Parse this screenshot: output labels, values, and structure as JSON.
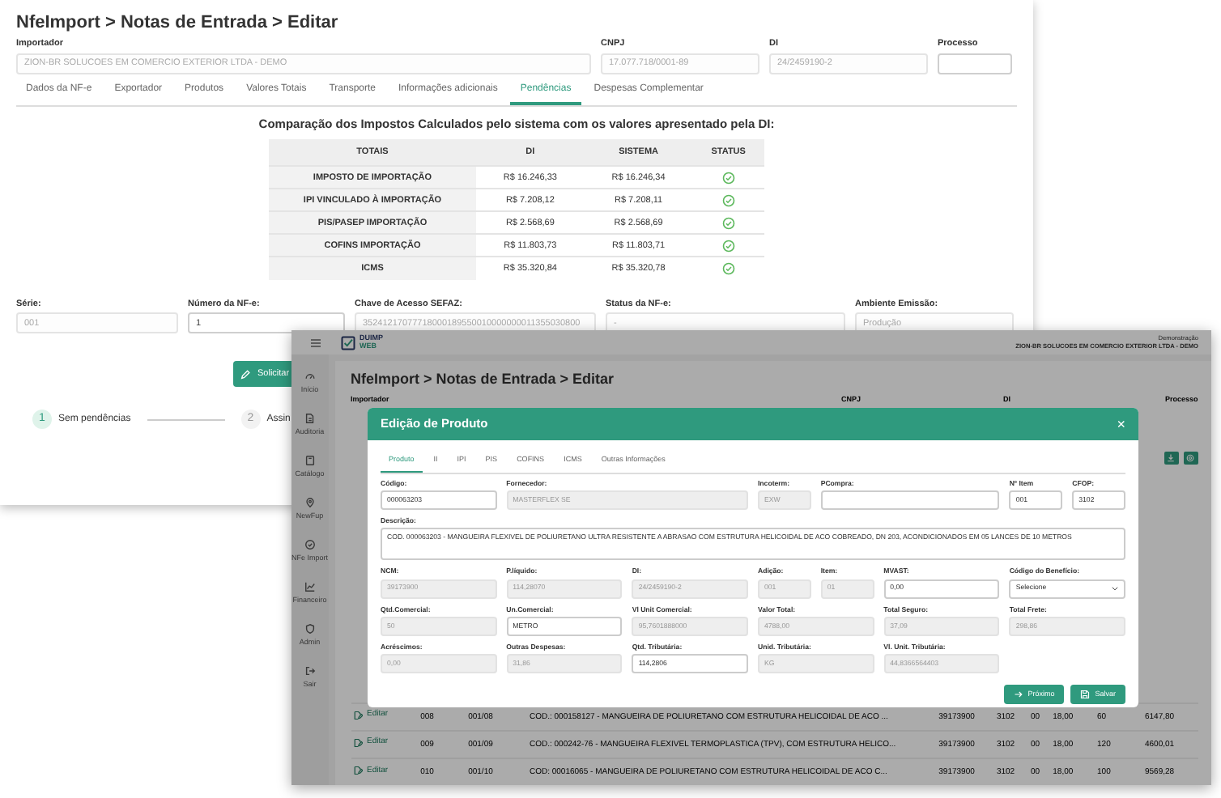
{
  "background_window": {
    "title": "NfeImport > Notas de Entrada > Editar",
    "header_fields": [
      {
        "label": "Importador",
        "value": "ZION-BR SOLUCOES EM COMERCIO EXTERIOR LTDA - DEMO",
        "disabled": true
      },
      {
        "label": "CNPJ",
        "value": "17.077.718/0001-89",
        "disabled": true
      },
      {
        "label": "DI",
        "value": "24/2459190-2",
        "disabled": true
      },
      {
        "label": "Processo",
        "disabled": false
      }
    ],
    "tabs": [
      {
        "label": "Dados da NF-e",
        "selected": false
      },
      {
        "label": "Exportador",
        "selected": false
      },
      {
        "label": "Produtos",
        "selected": false
      },
      {
        "label": "Valores Totais",
        "selected": false
      },
      {
        "label": "Transporte",
        "selected": false
      },
      {
        "label": "Informações adicionais",
        "selected": false
      },
      {
        "label": "Pendências",
        "selected": true
      },
      {
        "label": "Despesas Complementar",
        "selected": false
      }
    ],
    "comparison": {
      "heading": "Comparação dos Impostos Calculados pelo sistema com os valores apresentado pela DI:",
      "columns": [
        "TOTAIS",
        "DI",
        "SISTEMA",
        "STATUS"
      ],
      "rows": [
        {
          "label": "IMPOSTO DE IMPORTAÇÃO",
          "di": "R$ 16.246,33",
          "sistema": "R$ 16.246,34",
          "ok": true
        },
        {
          "label": "IPI VINCULADO À IMPORTAÇÃO",
          "di": "R$ 7.208,12",
          "sistema": "R$ 7.208,11",
          "ok": true
        },
        {
          "label": "PIS/PASEP IMPORTAÇÃO",
          "di": "R$ 2.568,69",
          "sistema": "R$ 2.568,69",
          "ok": true
        },
        {
          "label": "COFINS IMPORTAÇÃO",
          "di": "R$ 11.803,73",
          "sistema": "R$ 11.803,71",
          "ok": true
        },
        {
          "label": "ICMS",
          "di": "R$ 35.320,84",
          "sistema": "R$ 35.320,78",
          "ok": true
        }
      ]
    },
    "fields": [
      {
        "label": "Série:",
        "value": "001",
        "disabled": true
      },
      {
        "label": "Número da NF-e:",
        "value": "1",
        "disabled": false
      },
      {
        "label": "Chave de Acesso SEFAZ:",
        "value": "35241217077718000189550010000000011355030800",
        "disabled": true
      },
      {
        "label": "Status da NF-e:",
        "value": "-",
        "disabled": true
      },
      {
        "label": "Ambiente Emissão:",
        "value": "Produção",
        "disabled": true
      }
    ],
    "action_button": "Solicitar",
    "steps": [
      {
        "number": "1",
        "label": "Sem pendências",
        "active": true
      },
      {
        "number": "2",
        "label": "Assin",
        "active": false
      }
    ]
  },
  "app_window": {
    "brand": {
      "line_1": "DUIMP",
      "line_2": "WEB"
    },
    "user": {
      "role": "Demonstração",
      "company": "ZION-BR SOLUCOES EM COMERCIO EXTERIOR LTDA - DEMO"
    },
    "sidebar": [
      "Início",
      "Auditoria",
      "Catálogo",
      "NewFup",
      "NFe Import",
      "Financeiro",
      "Admin",
      "Sair"
    ],
    "page_title": "NfeImport > Notas de Entrada > Editar",
    "field_labels": [
      "Importador",
      "CNPJ",
      "DI",
      "Processo"
    ],
    "rows": [
      {
        "action": "Editar",
        "cells": [
          "008",
          "001/08",
          "COD.: 000158127 - MANGUEIRA DE POLIURETANO COM ESTRUTURA HELICOIDAL DE ACO ...",
          "39173900",
          "3102",
          "00",
          "18,00",
          "60",
          "6147,80"
        ]
      },
      {
        "action": "Editar",
        "cells": [
          "009",
          "001/09",
          "COD.: 000242-76 - MANGUEIRA FLEXIVEL TERMOPLASTICA (TPV), COM ESTRUTURA HELICO...",
          "39173900",
          "3102",
          "00",
          "18,00",
          "120",
          "4600,01"
        ]
      },
      {
        "action": "Editar",
        "cells": [
          "010",
          "001/10",
          "COD: 00016065 - MANGUEIRA DE POLIURETANO COM ESTRUTURA HELICOIDAL DE ACO C...",
          "39173900",
          "3102",
          "00",
          "18,00",
          "100",
          "9569,28"
        ]
      }
    ],
    "modal": {
      "title": "Edição de Produto",
      "close": "×",
      "tabs": [
        {
          "label": "Produto",
          "selected": true
        },
        {
          "label": "II",
          "selected": false
        },
        {
          "label": "IPI",
          "selected": false
        },
        {
          "label": "PIS",
          "selected": false
        },
        {
          "label": "COFINS",
          "selected": false
        },
        {
          "label": "ICMS",
          "selected": false
        },
        {
          "label": "Outras Informações",
          "selected": false
        }
      ],
      "fields": [
        {
          "label": "Código:",
          "value": "000063203",
          "kind": "input",
          "disabled": false
        },
        {
          "label": "Fornecedor:",
          "value": "MASTERFLEX SE",
          "kind": "input",
          "disabled": true
        },
        {
          "label": "Incoterm:",
          "value": "EXW",
          "kind": "input",
          "disabled": true
        },
        {
          "label": "PCompra:",
          "kind": "input",
          "disabled": false
        },
        {
          "label": "Nº Item",
          "value": "001",
          "kind": "input",
          "disabled": false
        },
        {
          "label": "CFOP:",
          "value": "3102",
          "kind": "input",
          "disabled": false
        },
        {
          "label": "Descrição:",
          "value": "COD. 000063203 - MANGUEIRA FLEXIVEL DE POLIURETANO ULTRA RESISTENTE A ABRASAO COM ESTRUTURA HELICOIDAL DE ACO COBREADO, DN 203, ACONDICIONADOS EM 05 LANCES DE 10 METROS",
          "kind": "textarea",
          "disabled": false
        },
        {
          "label": "NCM:",
          "value": "39173900",
          "kind": "input",
          "disabled": true
        },
        {
          "label": "P.líquido:",
          "value": "114,28070",
          "kind": "input",
          "disabled": true
        },
        {
          "label": "DI:",
          "value": "24/2459190-2",
          "kind": "input",
          "disabled": true
        },
        {
          "label": "Adição:",
          "value": "001",
          "kind": "input",
          "disabled": true
        },
        {
          "label": "Item:",
          "value": "01",
          "kind": "input",
          "disabled": true
        },
        {
          "label": "MVAST:",
          "value": "0,00",
          "kind": "input",
          "disabled": false
        },
        {
          "label": "Código do Benefício:",
          "value": "Selecione",
          "kind": "select",
          "disabled": false
        },
        {
          "label": "Qtd.Comercial:",
          "value": "50",
          "kind": "input",
          "disabled": true
        },
        {
          "label": "Un.Comercial:",
          "value": "METRO",
          "kind": "input",
          "disabled": false
        },
        {
          "label": "Vl Unit Comercial:",
          "value": "95,7601888000",
          "kind": "input",
          "disabled": true
        },
        {
          "label": "Valor Total:",
          "value": "4788,00",
          "kind": "input",
          "disabled": true
        },
        {
          "label": "Total Seguro:",
          "value": "37,09",
          "kind": "input",
          "disabled": true
        },
        {
          "label": "Total Frete:",
          "value": "298,86",
          "kind": "input",
          "disabled": true
        },
        {
          "label": "Acréscimos:",
          "value": "0,00",
          "kind": "input",
          "disabled": true
        },
        {
          "label": "Outras Despesas:",
          "value": "31,86",
          "kind": "input",
          "disabled": true
        },
        {
          "label": "Qtd. Tributária:",
          "value": "114,2806",
          "kind": "input",
          "disabled": false
        },
        {
          "label": "Unid. Tributária:",
          "value": "KG",
          "kind": "input",
          "disabled": true
        },
        {
          "label": "Vl. Unit. Tributária:",
          "value": "44,8366564403",
          "kind": "input",
          "disabled": true
        }
      ],
      "buttons": [
        {
          "label": "Próximo",
          "kind": "next"
        },
        {
          "label": "Salvar",
          "kind": "save"
        }
      ]
    }
  }
}
